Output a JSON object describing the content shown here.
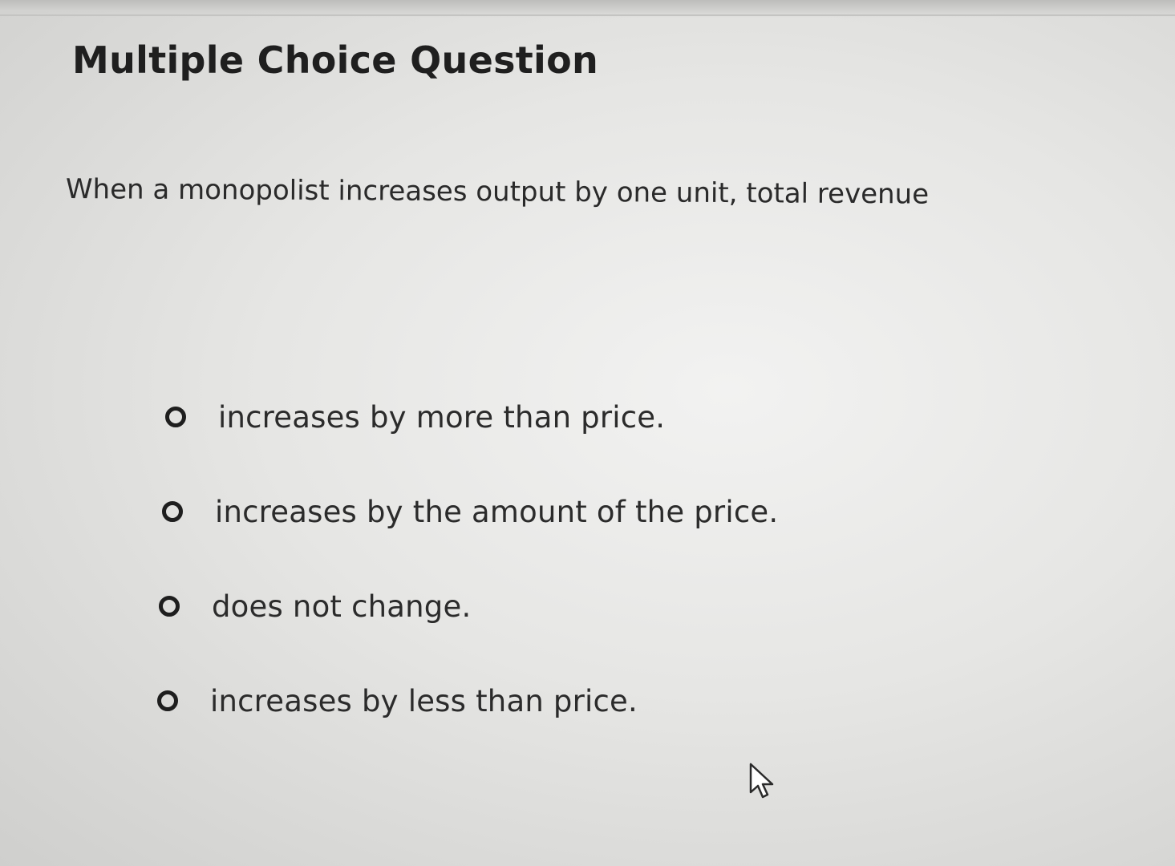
{
  "question_panel": {
    "heading": "Multiple Choice Question",
    "prompt": "When a monopolist increases output by one unit, total revenue",
    "options": [
      {
        "label": "increases by more than price.",
        "selected": false
      },
      {
        "label": "increases by the amount of the price.",
        "selected": false
      },
      {
        "label": "does not change.",
        "selected": false
      },
      {
        "label": "increases by less than price.",
        "selected": false
      }
    ]
  },
  "pointer": {
    "icon": "mouse-pointer-icon"
  }
}
